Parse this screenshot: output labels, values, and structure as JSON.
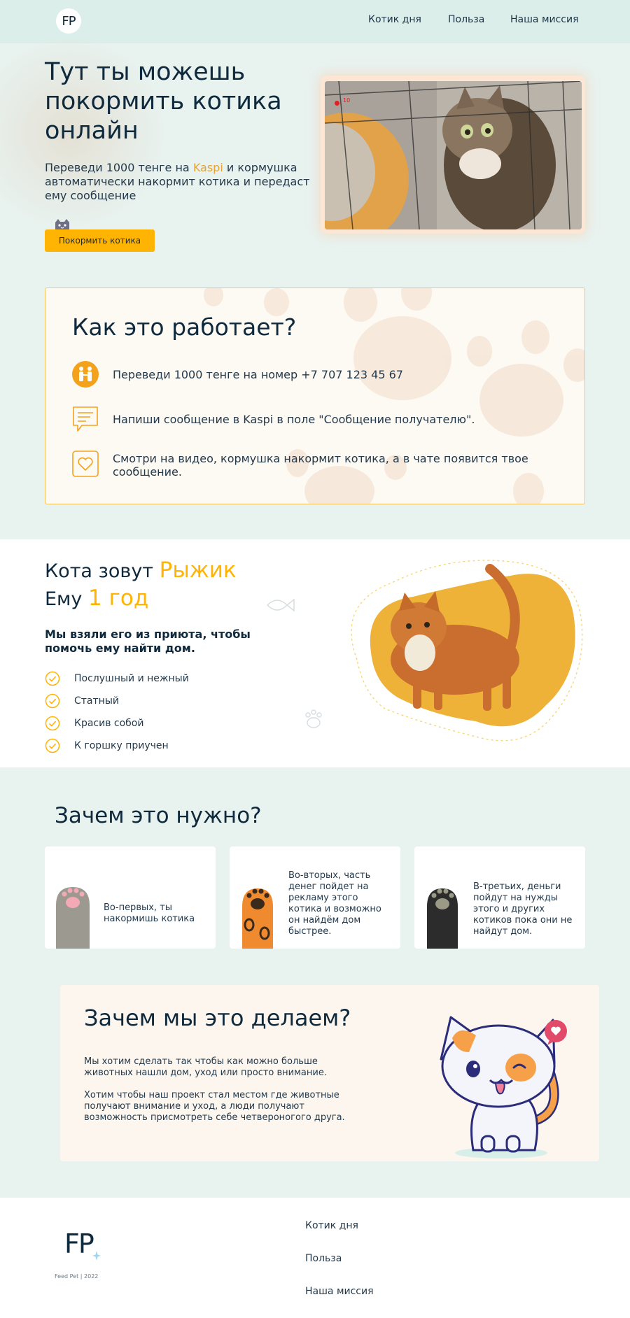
{
  "header": {
    "logo": "FP",
    "nav": [
      "Котик дня",
      "Польза",
      "Наша миссия"
    ]
  },
  "hero": {
    "title": "Тут ты можешь покормить котика онлайн",
    "text_before": "Переведи 1000 тенге на ",
    "text_kaspi": "Kaspi",
    "text_after": " и кормушка автоматически накормит котика и передаст ему сообщение",
    "button": "Покормить котика",
    "video_rec_label": "10"
  },
  "how": {
    "title": "Как это работает?",
    "steps": [
      "Переведи 1000 тенге на номер +7 707 123 45 67",
      "Напиши сообщение в Kaspi в поле \"Сообщение получателю\".",
      "Смотри на видео, кормушка накормит котика, а в чате появится твое сообщение."
    ]
  },
  "cat": {
    "name_prefix": "Кота зовут ",
    "name": "Рыжик",
    "age_prefix": "Ему ",
    "age": "1 год",
    "subtitle": "Мы взяли его из приюта, чтобы помочь ему найти дом.",
    "traits": [
      "Послушный и нежный",
      "Статный",
      "Красив собой",
      "К горшку приучен"
    ]
  },
  "why": {
    "title": "Зачем это нужно?",
    "cards": [
      "Во-первых, ты накормишь котика",
      "Во-вторых, часть денег пойдет на рекламу этого котика и возможно он найдём дом быстрее.",
      "В-третьих, деньги пойдут на нужды этого и других котиков пока они не найдут дом."
    ]
  },
  "mission": {
    "title": "Зачем мы это делаем?",
    "paragraph1": "Мы хотим сделать так чтобы как можно больше животных нашли дом, уход или просто внимание.",
    "paragraph2": "Хотим чтобы наш проект стал местом где животные  получают внимание и уход, а люди получают возможность присмотреть себе четвероногого друга."
  },
  "footer": {
    "logo": "FP",
    "copyright": "Feed Pet | 2022",
    "links": [
      "Котик дня",
      "Польза",
      "Наша миссия"
    ]
  },
  "colors": {
    "accent": "#ffb403",
    "background": "#e8f2ef",
    "text": "#0f2a3d",
    "card_border": "#f5c563"
  }
}
